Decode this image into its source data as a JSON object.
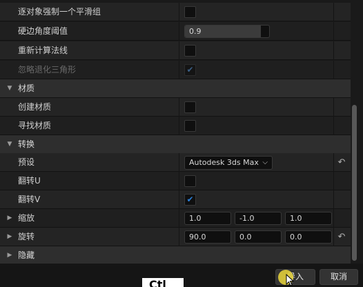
{
  "rows": {
    "smoothing_group": {
      "label": "逐对象强制一个平滑组",
      "checked": false
    },
    "hard_edge_angle": {
      "label": "硬边角度阈值",
      "value": "0.9",
      "fill_fraction": 0.9
    },
    "recompute_normals": {
      "label": "重新计算法线",
      "checked": false
    },
    "ignore_degenerate": {
      "label": "忽略退化三角形",
      "checked": true,
      "disabled": true
    },
    "material_category": {
      "label": "材质"
    },
    "create_materials": {
      "label": "创建材质",
      "checked": false
    },
    "find_materials": {
      "label": "寻找材质",
      "checked": false
    },
    "transform_category": {
      "label": "转换"
    },
    "preset": {
      "label": "预设",
      "value": "Autodesk 3ds Max"
    },
    "flip_u": {
      "label": "翻转U",
      "checked": false
    },
    "flip_v": {
      "label": "翻转V",
      "checked": true
    },
    "scale": {
      "label": "缩放",
      "x": "1.0",
      "y": "-1.0",
      "z": "1.0"
    },
    "rotation": {
      "label": "旋转",
      "x": "90.0",
      "y": "0.0",
      "z": "0.0"
    },
    "hidden_category": {
      "label": "隐藏"
    }
  },
  "icons": {
    "expanded": "▼",
    "collapsed": "▶",
    "check": "✔",
    "reset": "↶",
    "dropdown": "⌵"
  },
  "footer": {
    "import_label": "导入",
    "cancel_label": "取消"
  },
  "overlay": {
    "glyph": "Ctl"
  },
  "colors": {
    "accent": "#2a7fd8",
    "cursor": "#ebd73c"
  }
}
